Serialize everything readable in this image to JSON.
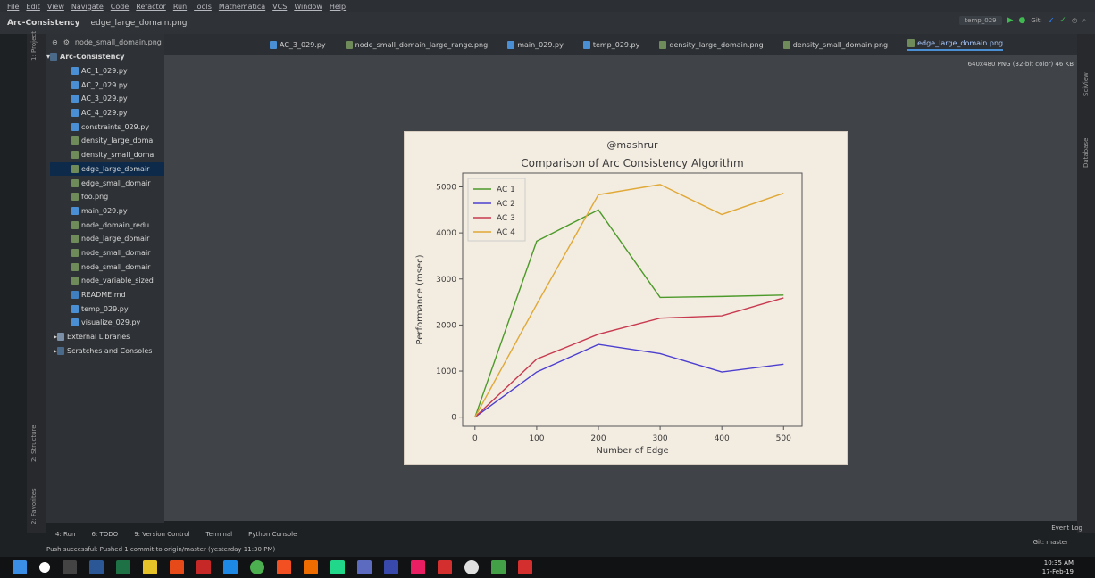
{
  "menu": [
    "File",
    "Edit",
    "View",
    "Navigate",
    "Code",
    "Refactor",
    "Run",
    "Tools",
    "Mathematica",
    "VCS",
    "Window",
    "Help"
  ],
  "breadcrumb": {
    "project": "Arc-Consistency",
    "file": "edge_large_domain.png"
  },
  "run_config": {
    "name": "temp_029",
    "git_label": "Git:"
  },
  "project_panel": {
    "tab_label": "1: Project",
    "toolbar_file": "node_small_domain.png",
    "root_label": "Arc-Consistency",
    "items": [
      {
        "name": "AC_1_029.py",
        "type": "py"
      },
      {
        "name": "AC_2_029.py",
        "type": "py"
      },
      {
        "name": "AC_3_029.py",
        "type": "py"
      },
      {
        "name": "AC_4_029.py",
        "type": "py"
      },
      {
        "name": "constraints_029.py",
        "type": "py"
      },
      {
        "name": "density_large_doma",
        "type": "png"
      },
      {
        "name": "density_small_doma",
        "type": "png"
      },
      {
        "name": "edge_large_domair",
        "type": "png"
      },
      {
        "name": "edge_small_domair",
        "type": "png"
      },
      {
        "name": "foo.png",
        "type": "png"
      },
      {
        "name": "main_029.py",
        "type": "py"
      },
      {
        "name": "node_domain_redu",
        "type": "png"
      },
      {
        "name": "node_large_domair",
        "type": "png"
      },
      {
        "name": "node_small_domair",
        "type": "png"
      },
      {
        "name": "node_small_domair",
        "type": "png"
      },
      {
        "name": "node_variable_sized",
        "type": "png"
      },
      {
        "name": "README.md",
        "type": "md"
      },
      {
        "name": "temp_029.py",
        "type": "py"
      },
      {
        "name": "visualize_029.py",
        "type": "py"
      }
    ],
    "external_libraries": "External Libraries",
    "scratches": "Scratches and Consoles"
  },
  "editor_tabs": [
    {
      "label": "AC_3_029.py",
      "type": "py"
    },
    {
      "label": "node_small_domain_large_range.png",
      "type": "png"
    },
    {
      "label": "main_029.py",
      "type": "py"
    },
    {
      "label": "temp_029.py",
      "type": "py"
    },
    {
      "label": "density_large_domain.png",
      "type": "png"
    },
    {
      "label": "density_small_domain.png",
      "type": "png"
    },
    {
      "label": "edge_large_domain.png",
      "type": "png",
      "active": true
    }
  ],
  "image_info": "640x480 PNG (32-bit color) 46 KB",
  "side_labels": {
    "structure": "2: Structure",
    "favorites": "2: Favorites",
    "scview": "SciView",
    "database": "Database"
  },
  "chart_data": {
    "type": "line",
    "title_top": "@mashrur",
    "title": "Comparison of Arc Consistency Algorithm",
    "xlabel": "Number of Edge",
    "ylabel": "Performance (msec)",
    "xlim": [
      -20,
      530
    ],
    "ylim": [
      -200,
      5300
    ],
    "xticks": [
      0,
      100,
      200,
      300,
      400,
      500
    ],
    "yticks": [
      0,
      1000,
      2000,
      3000,
      4000,
      5000
    ],
    "x": [
      0,
      100,
      200,
      300,
      400,
      500
    ],
    "legend_position": "top-left",
    "series": [
      {
        "name": "AC 1",
        "color": "#4c9a2a",
        "values": [
          0,
          3820,
          4500,
          2600,
          2620,
          2650
        ]
      },
      {
        "name": "AC 2",
        "color": "#4c3fd0",
        "values": [
          0,
          980,
          1580,
          1380,
          980,
          1150
        ]
      },
      {
        "name": "AC 3",
        "color": "#c83a4f",
        "values": [
          0,
          1260,
          1800,
          2150,
          2200,
          2590
        ]
      },
      {
        "name": "AC 4",
        "color": "#e0a836",
        "values": [
          0,
          2450,
          4830,
          5050,
          4400,
          4860
        ]
      }
    ]
  },
  "bottom_tools": [
    "4: Run",
    "6: TODO",
    "9: Version Control",
    "Terminal",
    "Python Console"
  ],
  "status_message": "Push successful: Pushed 1 commit to origin/master (yesterday 11:30 PM)",
  "event_log": "Event Log",
  "git_branch": "Git: master",
  "clock": {
    "time": "10:35 AM",
    "date": "17-Feb-19"
  }
}
